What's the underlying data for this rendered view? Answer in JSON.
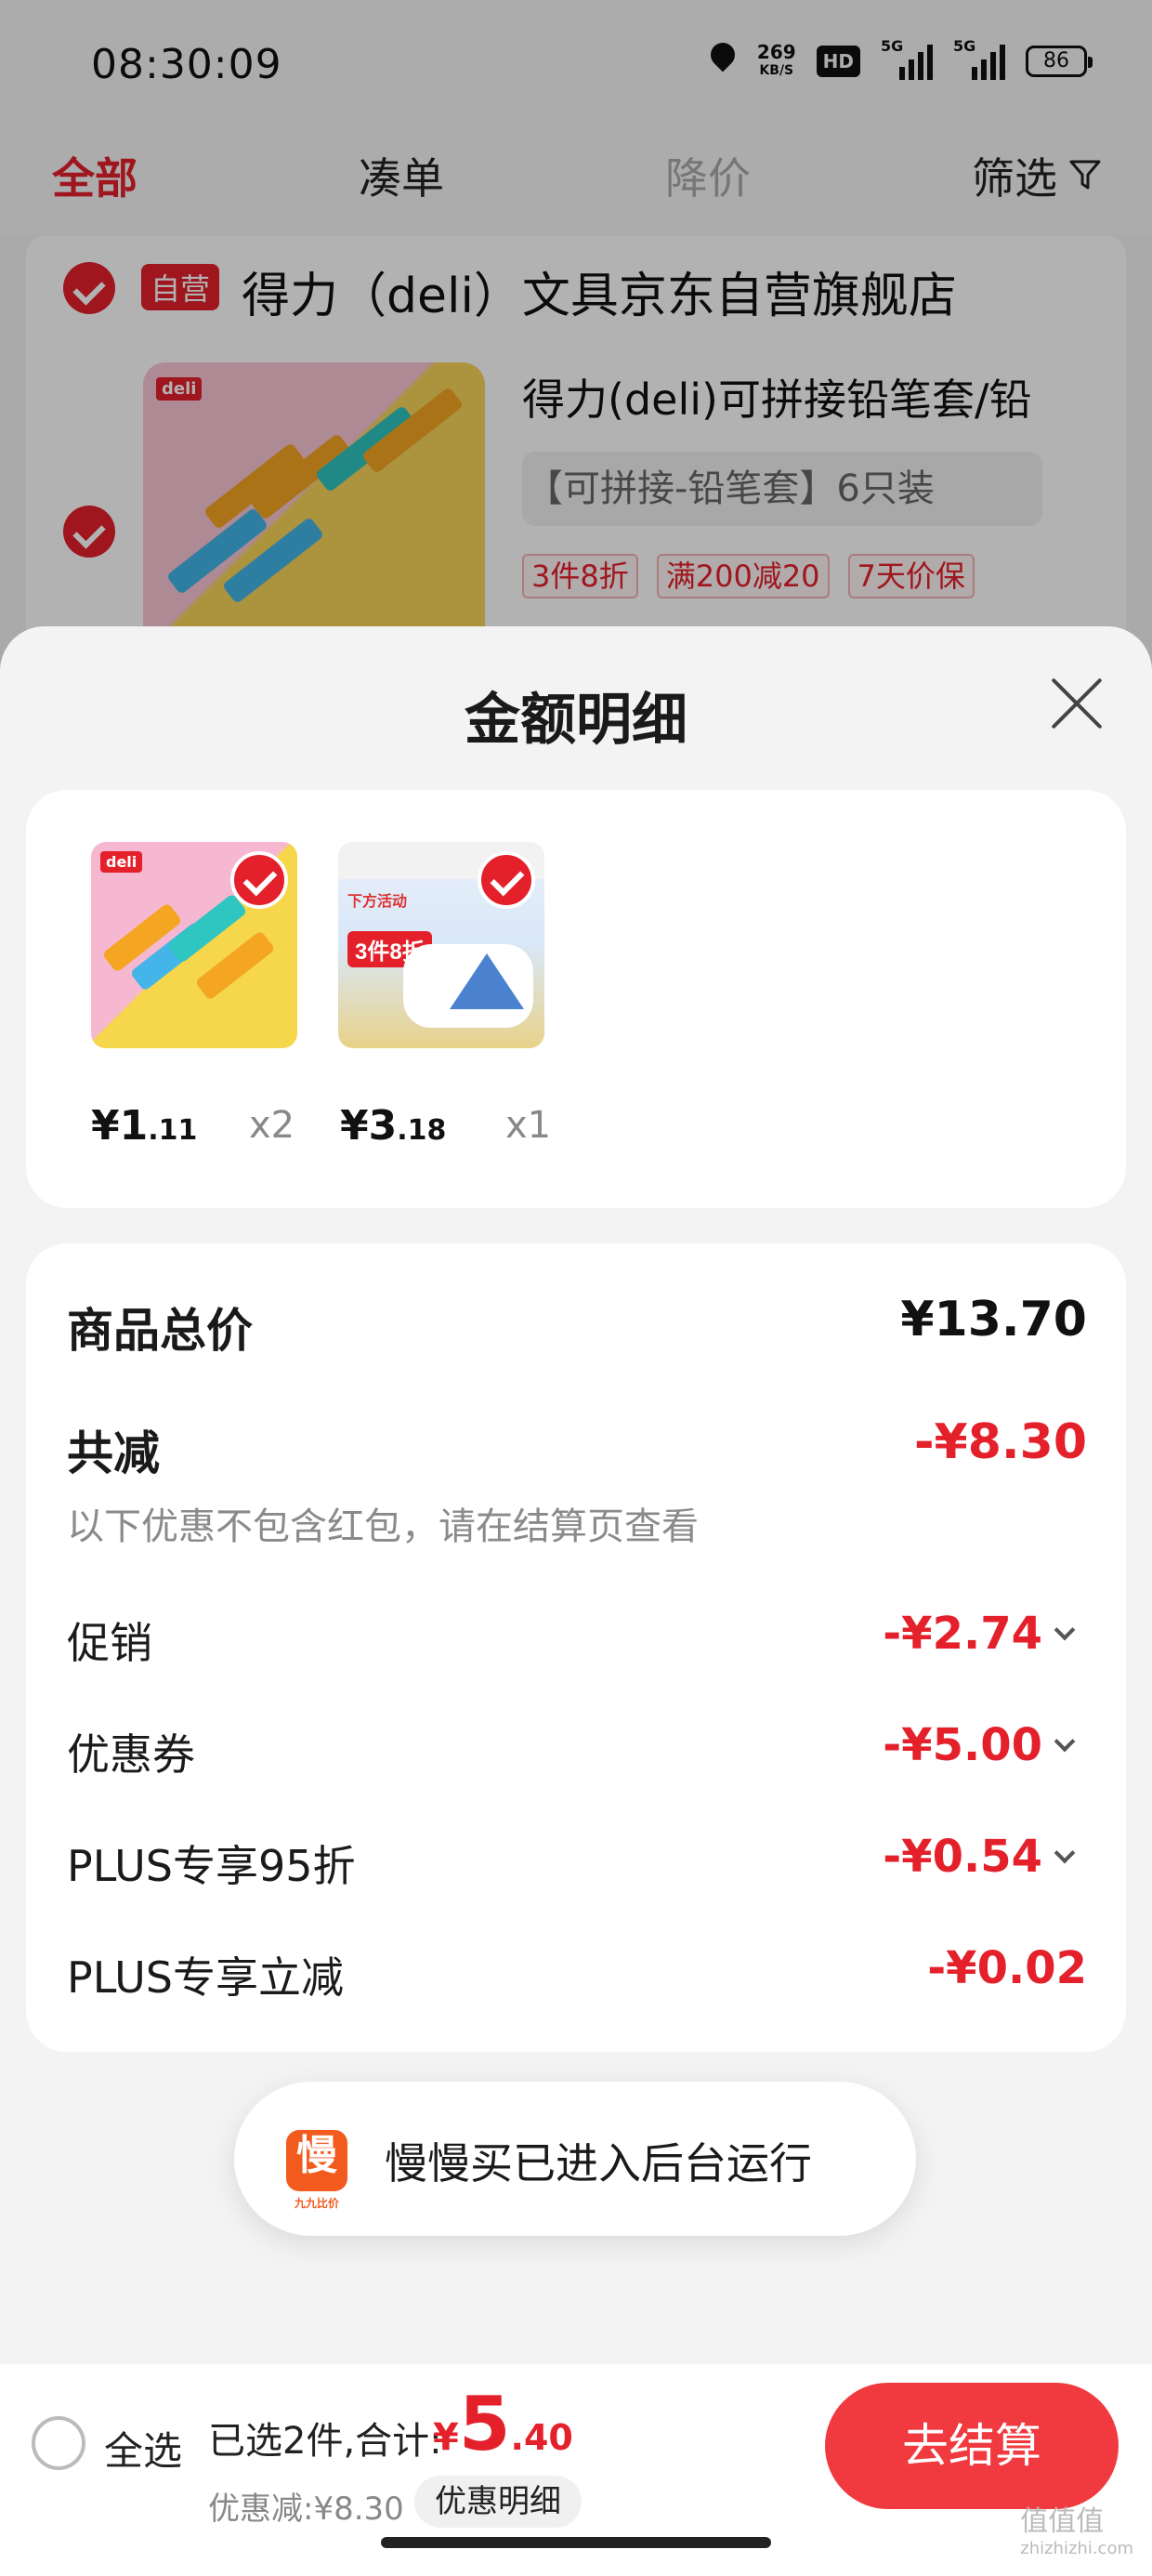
{
  "status_bar": {
    "time": "08:30:09",
    "speed_value": "269",
    "speed_unit": "KB/S",
    "hd": "HD",
    "signal1": "5G",
    "signal2": "5G",
    "battery": "86"
  },
  "tabs": [
    {
      "label": "全部",
      "active": true
    },
    {
      "label": "凑单"
    },
    {
      "label": "降价",
      "disabled": true
    },
    {
      "label": "筛选"
    }
  ],
  "background_store": {
    "badge": "自营",
    "name": "得力（deli）文具京东自营旗舰店",
    "product_title": "得力(deli)可拼接铅笔套/铅",
    "variant": "【可拼接-铅笔套】6只装",
    "tags": [
      "3件8折",
      "满200减20",
      "7天价保"
    ],
    "thumb_logo": "deli"
  },
  "sheet": {
    "title": "金额明细",
    "items": [
      {
        "price_int": "¥1",
        "price_dec": ".11",
        "qty": "x2",
        "logo": "deli"
      },
      {
        "price_int": "¥3",
        "price_dec": ".18",
        "qty": "x1",
        "badge": "3件8折",
        "label": "下方活动"
      }
    ],
    "rows": {
      "total_label": "商品总价",
      "total_value": "¥13.70",
      "reduce_label": "共减",
      "reduce_value": "-¥8.30",
      "reduce_note": "以下优惠不包含红包，请在结算页查看",
      "promo_label": "促销",
      "promo_value": "-¥2.74",
      "coupon_label": "优惠券",
      "coupon_value": "-¥5.00",
      "plus95_label": "PLUS专享95折",
      "plus95_value": "-¥0.54",
      "plusdirect_label": "PLUS专享立减",
      "plusdirect_value": "-¥0.02"
    }
  },
  "toast": {
    "icon_char": "慢",
    "icon_sub": "九九比价",
    "text": "慢慢买已进入后台运行"
  },
  "bottom_bar": {
    "select_all": "全选",
    "summary": "已选2件,合计:",
    "total_yen": "¥",
    "total_int": "5",
    "total_dec": ".40",
    "discount": "优惠减:¥8.30",
    "detail_button": "优惠明细",
    "checkout_button": "去结算"
  },
  "watermark": {
    "text": "值值值",
    "sub": "zhizhizhi.com"
  },
  "colors": {
    "accent": "#e4202b",
    "checkout": "#f03a3f"
  }
}
